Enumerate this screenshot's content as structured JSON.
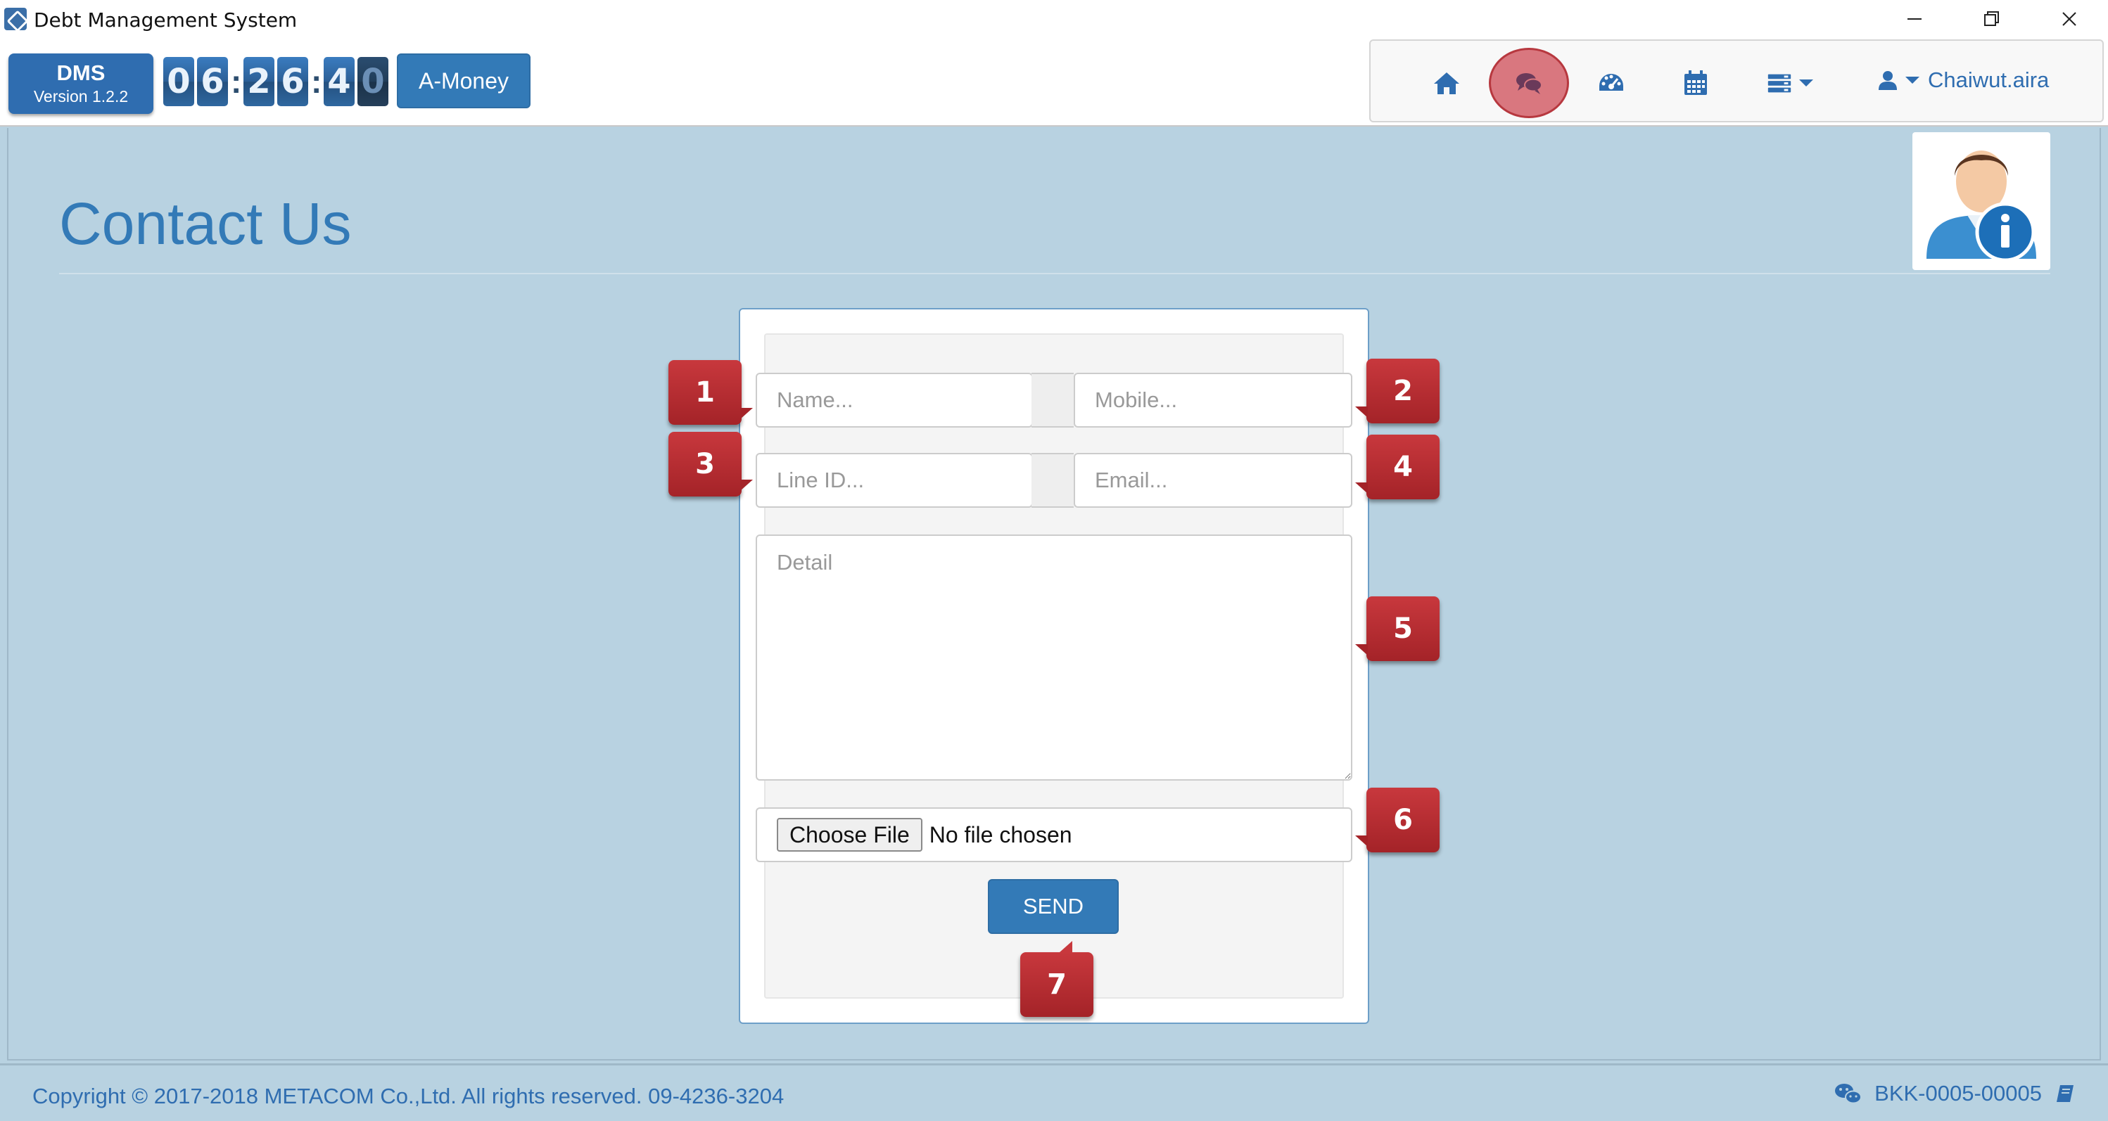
{
  "window": {
    "title": "Debt Management System"
  },
  "header": {
    "brand": "DMS",
    "version": "Version 1.2.2",
    "clock_digits": [
      "0",
      "6",
      "2",
      "6",
      "4",
      "0"
    ],
    "company_button": "A-Money",
    "user_name": "Chaiwut.aira",
    "nav_icons": [
      "home-icon",
      "chat-icon",
      "dashboard-icon",
      "calendar-icon",
      "server-menu-icon"
    ]
  },
  "page": {
    "title": "Contact Us"
  },
  "form": {
    "name_placeholder": "Name...",
    "mobile_placeholder": "Mobile...",
    "line_placeholder": "Line ID...",
    "email_placeholder": "Email...",
    "detail_placeholder": "Detail",
    "file_button": "Choose File",
    "file_status": "No file chosen",
    "send_label": "SEND"
  },
  "callouts": [
    "1",
    "2",
    "3",
    "4",
    "5",
    "6",
    "7"
  ],
  "footer": {
    "copyright": "Copyright © 2017-2018 METACOM Co.,Ltd. All rights reserved. 09-4236-3204",
    "branch_code": "BKK-0005-00005"
  },
  "colors": {
    "primary": "#337ab7",
    "background": "#b8d2e1",
    "callout": "#b52d32",
    "active_nav": "#d9777f"
  }
}
